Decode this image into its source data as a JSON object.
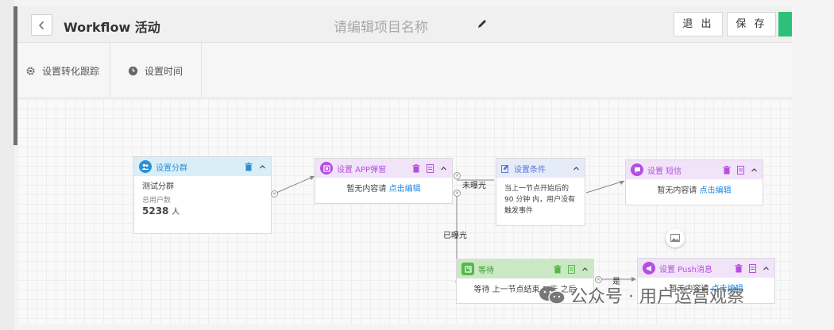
{
  "header": {
    "back_icon": "chevron-left-icon",
    "title": "Workflow 活动",
    "project_name": "请编辑项目名称",
    "edit_icon": "pencil-icon",
    "exit_label": "退 出",
    "save_label": "保 存",
    "accent": "#2ec07a"
  },
  "toolbar": {
    "conversion": {
      "icon": "gear-icon",
      "label": "设置转化跟踪"
    },
    "time": {
      "icon": "clock-icon",
      "label": "设置时间"
    }
  },
  "nodes": {
    "segment": {
      "title": "设置分群",
      "group_name": "测试分群",
      "users_label": "总用户数",
      "users_count": "5238",
      "users_unit": "人",
      "color": "#2a8fd6",
      "icon": "users-icon"
    },
    "app_popup": {
      "title": "设置 APP弹窗",
      "empty_text": "暂无内容请",
      "edit_link": "点击编辑",
      "color": "#b44fe0",
      "icon": "popup-icon"
    },
    "condition": {
      "title": "设置条件",
      "desc_line1": "当上一节点开始后的",
      "desc_line2": "90 分钟 内，用户没有",
      "desc_line3": "触发事件",
      "color": "#5a7ad6",
      "icon": "edit-check-icon"
    },
    "sms": {
      "title": "设置 短信",
      "empty_text": "暂无内容请",
      "edit_link": "点击编辑",
      "color": "#b44fe0",
      "icon": "message-icon"
    },
    "wait": {
      "title": "等待",
      "desc": "等待 上一节点结束 1 天 之后",
      "color": "#55b849",
      "icon": "wait-icon"
    },
    "push": {
      "title": "设置 Push消息",
      "empty_text": "暂无内容请",
      "edit_link": "点击编辑",
      "color": "#b44fe0",
      "icon": "megaphone-icon"
    }
  },
  "edges": {
    "not_exposed": "未曝光",
    "exposed": "已曝光",
    "yes": "是"
  },
  "watermark": "公众号 · 用户运营观察"
}
